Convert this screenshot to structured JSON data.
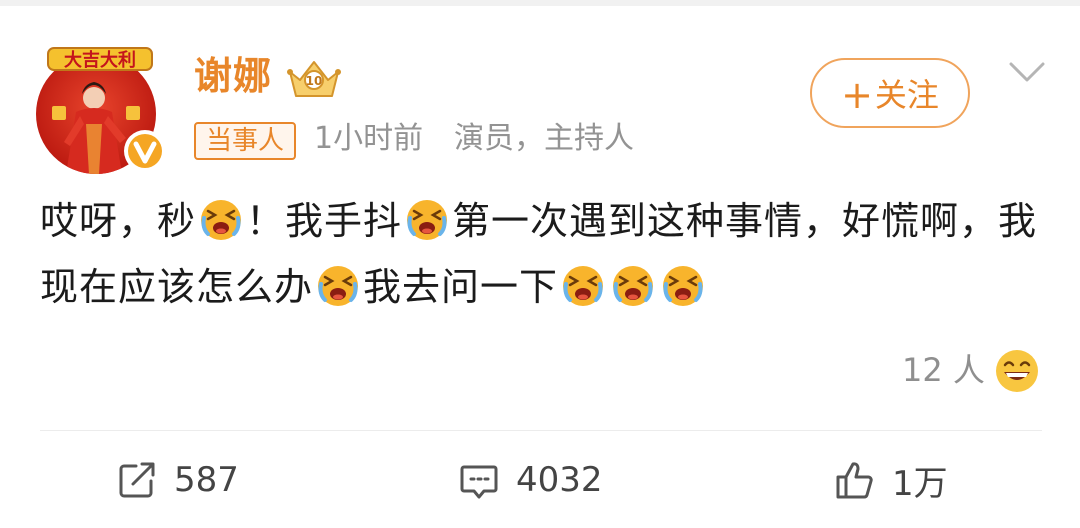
{
  "author": {
    "name": "谢娜",
    "avatar_text": "大吉大利",
    "verified": true
  },
  "meta": {
    "tag": "当事人",
    "time": "1小时前",
    "title": "演员，主持人"
  },
  "follow_label": "关注",
  "post": {
    "segments": [
      "哎呀，秒",
      "！我手抖",
      "第一次遇到这种事情，好慌啊，我现在应该怎么办",
      "我去问一下"
    ],
    "emoji": "crying-face-icon"
  },
  "reactions": {
    "count": "12 人",
    "emoji": "grinning-face-icon"
  },
  "actions": {
    "repost_count": "587",
    "comment_count": "4032",
    "like_count": "1万"
  },
  "colors": {
    "accent": "#e8862a",
    "muted": "#939393",
    "text": "#1b1b1b"
  }
}
